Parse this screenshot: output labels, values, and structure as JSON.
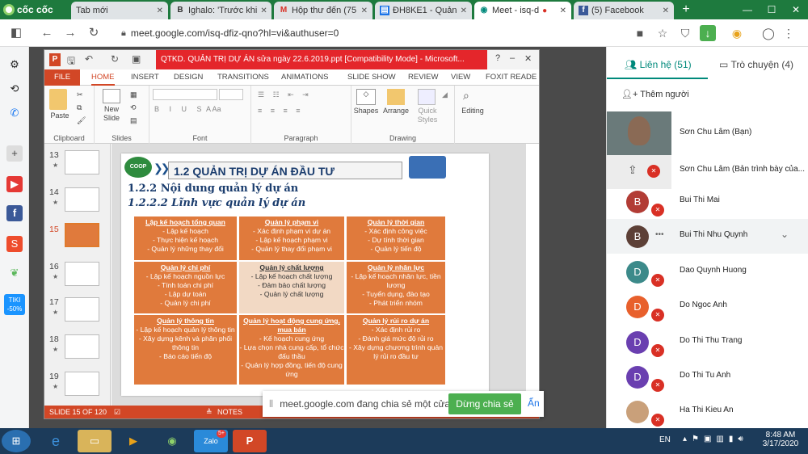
{
  "browser": {
    "brand": "cốc cốc",
    "tabs": [
      {
        "label": "Tab mới",
        "icon": "new-tab-icon"
      },
      {
        "label": "Ighalo: 'Trước khi",
        "icon": "bold-b-icon"
      },
      {
        "label": "Hộp thư đến (75",
        "icon": "gmail-icon"
      },
      {
        "label": "ĐH8KE1 - Quản",
        "icon": "classroom-icon"
      },
      {
        "label": "Meet - isq-d",
        "icon": "meet-icon"
      },
      {
        "label": "(5) Facebook",
        "icon": "facebook-icon"
      }
    ],
    "new_tab": "+",
    "url": "meet.google.com/isq-dfiz-qno?hl=vi&authuser=0"
  },
  "sidebar_left": {
    "badge": "TIKI -50%",
    "icons": [
      "sidebar-toggle-icon",
      "settings-icon",
      "history-icon",
      "messenger-icon",
      "add-icon",
      "youtube-icon",
      "facebook-icon",
      "shopee-icon",
      "leaf-icon",
      "tiki-icon"
    ]
  },
  "powerpoint": {
    "title": "QTKD. QUẢN TRỊ DỰ ÁN sửa ngày 22.6.2019.ppt [Compatibility Mode] - Microsoft...",
    "ribbon_tabs": [
      "FILE",
      "HOME",
      "INSERT",
      "DESIGN",
      "TRANSITIONS",
      "ANIMATIONS",
      "SLIDE SHOW",
      "REVIEW",
      "VIEW",
      "FOXIT READE"
    ],
    "active_tab": "HOME",
    "groups": {
      "clipboard": "Clipboard",
      "slides": "Slides",
      "font": "Font",
      "paragraph": "Paragraph",
      "drawing": "Drawing",
      "editing_label": "Editing"
    },
    "buttons": {
      "paste": "Paste",
      "new_slide_1": "New",
      "new_slide_2": "Slide",
      "shapes": "Shapes",
      "arrange": "Arrange",
      "quick_1": "Quick",
      "quick_2": "Styles",
      "editing": "Editing"
    },
    "thumbnails": [
      "13",
      "14",
      "15",
      "16",
      "17",
      "18",
      "19"
    ],
    "selected_slide": "15",
    "status_slide": "SLIDE 15 OF 120",
    "status_notes": "NOTES",
    "slide": {
      "header": "1.2 QUẢN TRỊ DỰ ÁN ĐẦU TƯ",
      "logo_text": "COOP",
      "sub1": "1.2.2 Nội dung quản lý dự án",
      "sub2": "1.2.2.2 Lĩnh vực quản lý dự án",
      "cells": [
        {
          "title": "Lập kế hoạch tổng quan",
          "lines": [
            "- Lập kế hoạch",
            "- Thực hiện kế hoạch",
            "- Quản lý những thay đổi"
          ]
        },
        {
          "title": "Quản lý phạm vi",
          "lines": [
            "- Xác định phạm vi dự án",
            "- Lập kế hoạch phạm vi",
            "- Quản lý thay đổi phạm vi"
          ]
        },
        {
          "title": "Quản lý thời gian",
          "lines": [
            "- Xác định công việc",
            "- Dự tính thời gian",
            "- Quản lý tiến độ"
          ]
        },
        {
          "title": "Quản lý chi phí",
          "lines": [
            "- Lập kế hoạch nguồn lực",
            "- Tính toán chi phí",
            "- Lập dự toán",
            "- Quản lý chi phí"
          ]
        },
        {
          "title": "Quản lý chất lượng",
          "lines": [
            "- Lập kế hoạch chất lượng",
            "- Đảm bảo chất lượng",
            "- Quản lý chất lượng"
          ]
        },
        {
          "title": "Quản lý nhân lực",
          "lines": [
            "- Lập kế hoạch nhân lực, tiền lương",
            "- Tuyển dụng, đào tạo",
            "- Phát triển nhóm"
          ]
        },
        {
          "title": "Quản lý thông tin",
          "lines": [
            "- Lập kế hoạch quản lý thông tin",
            "- Xây dựng kênh và phân phối thông tin",
            "- Báo cáo tiến độ"
          ]
        },
        {
          "title": "Quản lý hoạt động cung ứng, mua bán",
          "lines": [
            "- Kế hoạch cung ứng",
            "- Lựa chọn nhà cung cấp, tổ chức đấu thầu",
            "- Quản lý hợp đồng, tiến độ cung ứng"
          ]
        },
        {
          "title": "Quản lý rủi ro dự án",
          "lines": [
            "- Xác định rủi ro",
            "- Đánh giá mức độ rủi ro",
            "- Xây dựng chương trình quản lý rủi ro đầu tư"
          ]
        }
      ]
    }
  },
  "share_notice": {
    "text": "meet.google.com đang chia sẻ một cửa sổ.",
    "stop": "Dừng chia sẻ",
    "hide": "Ẩn"
  },
  "meet_panel": {
    "tab_people": "Liên hệ (51)",
    "tab_chat": "Trò chuyện (4)",
    "add_people": "Thêm người",
    "people": [
      {
        "name": "Sơn Chu Lâm (Bạn)",
        "initial": "",
        "color": "#6d6d6d"
      },
      {
        "name": "Sơn Chu Lâm (Bản trình bày của...",
        "initial": "",
        "color": "#6d6d6d"
      },
      {
        "name": "Bui Thi Mai",
        "initial": "B",
        "color": "#b23c35"
      },
      {
        "name": "Bui Thi Nhu Quynh",
        "initial": "B",
        "color": "#5d4037"
      },
      {
        "name": "Dao Quynh Huong",
        "initial": "D",
        "color": "#3c8a8a"
      },
      {
        "name": "Do Ngoc Anh",
        "initial": "D",
        "color": "#e8602c"
      },
      {
        "name": "Do Thi Thu Trang",
        "initial": "D",
        "color": "#6a3fb0"
      },
      {
        "name": "Do Thi Tu Anh",
        "initial": "D",
        "color": "#6a3fb0"
      },
      {
        "name": "Ha Thi Kieu An",
        "initial": "",
        "color": "#c9a07a"
      }
    ]
  },
  "taskbar": {
    "lang": "EN",
    "time": "8:48 AM",
    "date": "3/17/2020",
    "zalo_badge": "5+"
  }
}
